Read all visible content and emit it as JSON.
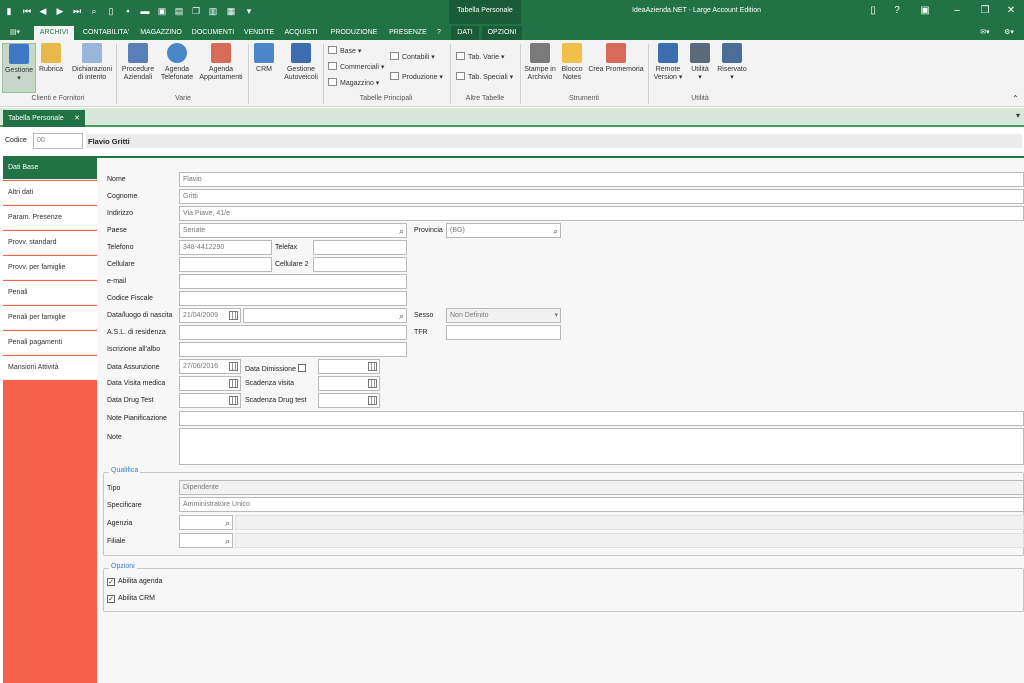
{
  "app": {
    "title": "IdeaAzienda.NET - Large Account Edition",
    "context_tab": "Tabella Personale",
    "accent": "#217346",
    "sidebar_color": "#f5614a"
  },
  "menu_tabs": [
    "ARCHIVI",
    "CONTABILITA'",
    "MAGAZZINO",
    "DOCUMENTI",
    "VENDITE",
    "ACQUISTI",
    "PRODUZIONE",
    "PRESENZE",
    "?",
    "DATI",
    "OPZIONI"
  ],
  "ribbon": {
    "gestione": "Gestione",
    "rubrica": "Rubrica",
    "dichiarazioni": [
      "Dichiarazioni",
      "di intento"
    ],
    "procedure": [
      "Procedure",
      "Aziendali"
    ],
    "agenda_tel": [
      "Agenda",
      "Telefonate"
    ],
    "agenda_app": [
      "Agenda",
      "Appuntamenti"
    ],
    "crm": "CRM",
    "autoveicoli": [
      "Gestione",
      "Autoveicoli"
    ],
    "base": "Base",
    "commerciali": "Commerciali",
    "magazzino": "Magazzino",
    "contabili": "Contabili",
    "produzione": "Produzione",
    "tab_varie": "Tab. Varie",
    "tab_speciali": "Tab. Speciali",
    "stampe": [
      "Stampe in",
      "Archivio"
    ],
    "blocco": [
      "Blocco",
      "Notes"
    ],
    "promemoria": "Crea Promemoria",
    "remote": [
      "Remote",
      "Version"
    ],
    "utilita": "Utilità",
    "riservato": "Riservato",
    "groups": {
      "clienti": "Clienti e Fornitori",
      "varie": "Varie",
      "tabelle_principali": "Tabelle Principali",
      "altre_tabelle": "Altre Tabelle",
      "strumenti": "Strumenti",
      "utilita": "Utilità"
    }
  },
  "doc_tab": "Tabella Personale",
  "header": {
    "codice_label": "Codice",
    "codice_value": "00",
    "name": "Flavio Gritti"
  },
  "sidebar": [
    "Dati Base",
    "Altri dati",
    "Param. Presenze",
    "Provv. standard",
    "Provv. per famiglie",
    "Penali",
    "Penali per famiglie",
    "Penali pagamenti",
    "Mansioni Attività"
  ],
  "form": {
    "nome": {
      "label": "Nome",
      "value": "Flavio"
    },
    "cognome": {
      "label": "Cognome",
      "value": "Gritti"
    },
    "indirizzo": {
      "label": "Indirizzo",
      "value": "Via Piave, 41/e"
    },
    "paese": {
      "label": "Paese",
      "value": "Seriate"
    },
    "provincia": {
      "label": "Provincia",
      "value": "(BG)"
    },
    "telefono": {
      "label": "Telefono",
      "value": "348-4412290"
    },
    "telefax": {
      "label": "Telefax",
      "value": ""
    },
    "cellulare": {
      "label": "Cellulare",
      "value": ""
    },
    "cellulare2": {
      "label": "Cellulare 2",
      "value": ""
    },
    "email": {
      "label": "e-mail",
      "value": ""
    },
    "cf": {
      "label": "Codice Fiscale",
      "value": ""
    },
    "nascita": {
      "label": "Data/luogo di nascita",
      "value": "21/04/2009"
    },
    "sesso": {
      "label": "Sesso",
      "value": "Non Definito"
    },
    "asl": {
      "label": "A.S.L. di residenza",
      "value": ""
    },
    "tfr": {
      "label": "TFR",
      "value": ""
    },
    "albo": {
      "label": "Iscrizione all'albo",
      "value": ""
    },
    "assunzione": {
      "label": "Data Assunzione",
      "value": "27/06/2016"
    },
    "dimissione": {
      "label": "Data Dimissione",
      "value": ""
    },
    "visita": {
      "label": "Data Visita medica",
      "value": ""
    },
    "scad_visita": {
      "label": "Scadenza visita",
      "value": ""
    },
    "drug": {
      "label": "Data Drug Test",
      "value": ""
    },
    "scad_drug": {
      "label": "Scadenza Drug test",
      "value": ""
    },
    "note_pian": {
      "label": "Note Pianificazione",
      "value": ""
    },
    "note": {
      "label": "Note",
      "value": ""
    }
  },
  "qualifica": {
    "legend": "Qualifica",
    "tipo": {
      "label": "Tipo",
      "value": "Dipendente"
    },
    "specificare": {
      "label": "Specificare",
      "value": "Amministratore Unico"
    },
    "agenzia": {
      "label": "Agenzia",
      "value": ""
    },
    "filiale": {
      "label": "Filiale",
      "value": ""
    }
  },
  "opzioni": {
    "legend": "Opzioni",
    "agenda": {
      "label": "Abilita agenda",
      "checked": true
    },
    "crm": {
      "label": "Abilita CRM",
      "checked": true
    }
  }
}
